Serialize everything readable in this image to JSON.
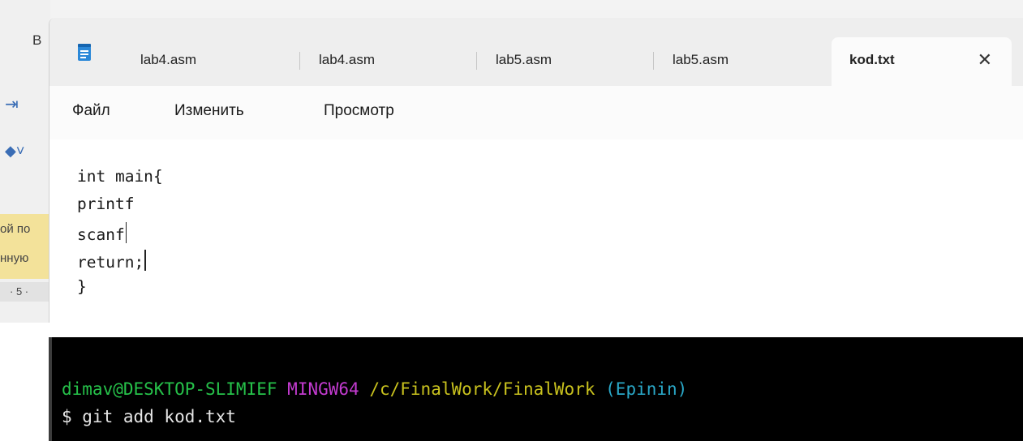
{
  "background_app": {
    "letter": "В",
    "highlight_lines": [
      "ой по",
      "нную"
    ],
    "ruler_text": "· 5 ·"
  },
  "notepad": {
    "tabs": [
      {
        "label": "lab4.asm",
        "active": false
      },
      {
        "label": "lab4.asm",
        "active": false
      },
      {
        "label": "lab5.asm",
        "active": false
      },
      {
        "label": "lab5.asm",
        "active": false
      },
      {
        "label": "kod.txt",
        "active": true
      }
    ],
    "close_glyph": "✕",
    "menu": {
      "file": "Файл",
      "edit": "Изменить",
      "view": "Просмотр"
    },
    "content_lines": [
      "int main{",
      "printf",
      "scanf",
      "return;",
      "}"
    ]
  },
  "terminal": {
    "prompt": {
      "user_host": "dimav@DESKTOP-SLIMIEF",
      "system": "MINGW64",
      "path": "/c/FinalWork/FinalWork",
      "branch": "(Epinin)"
    },
    "command_line": "$ git add kod.txt"
  },
  "colors": {
    "terminal_bg": "#000000",
    "prompt_user": "#26c24a",
    "prompt_system": "#c33bd0",
    "prompt_path": "#c9c21e",
    "prompt_branch": "#2aa9c9"
  }
}
